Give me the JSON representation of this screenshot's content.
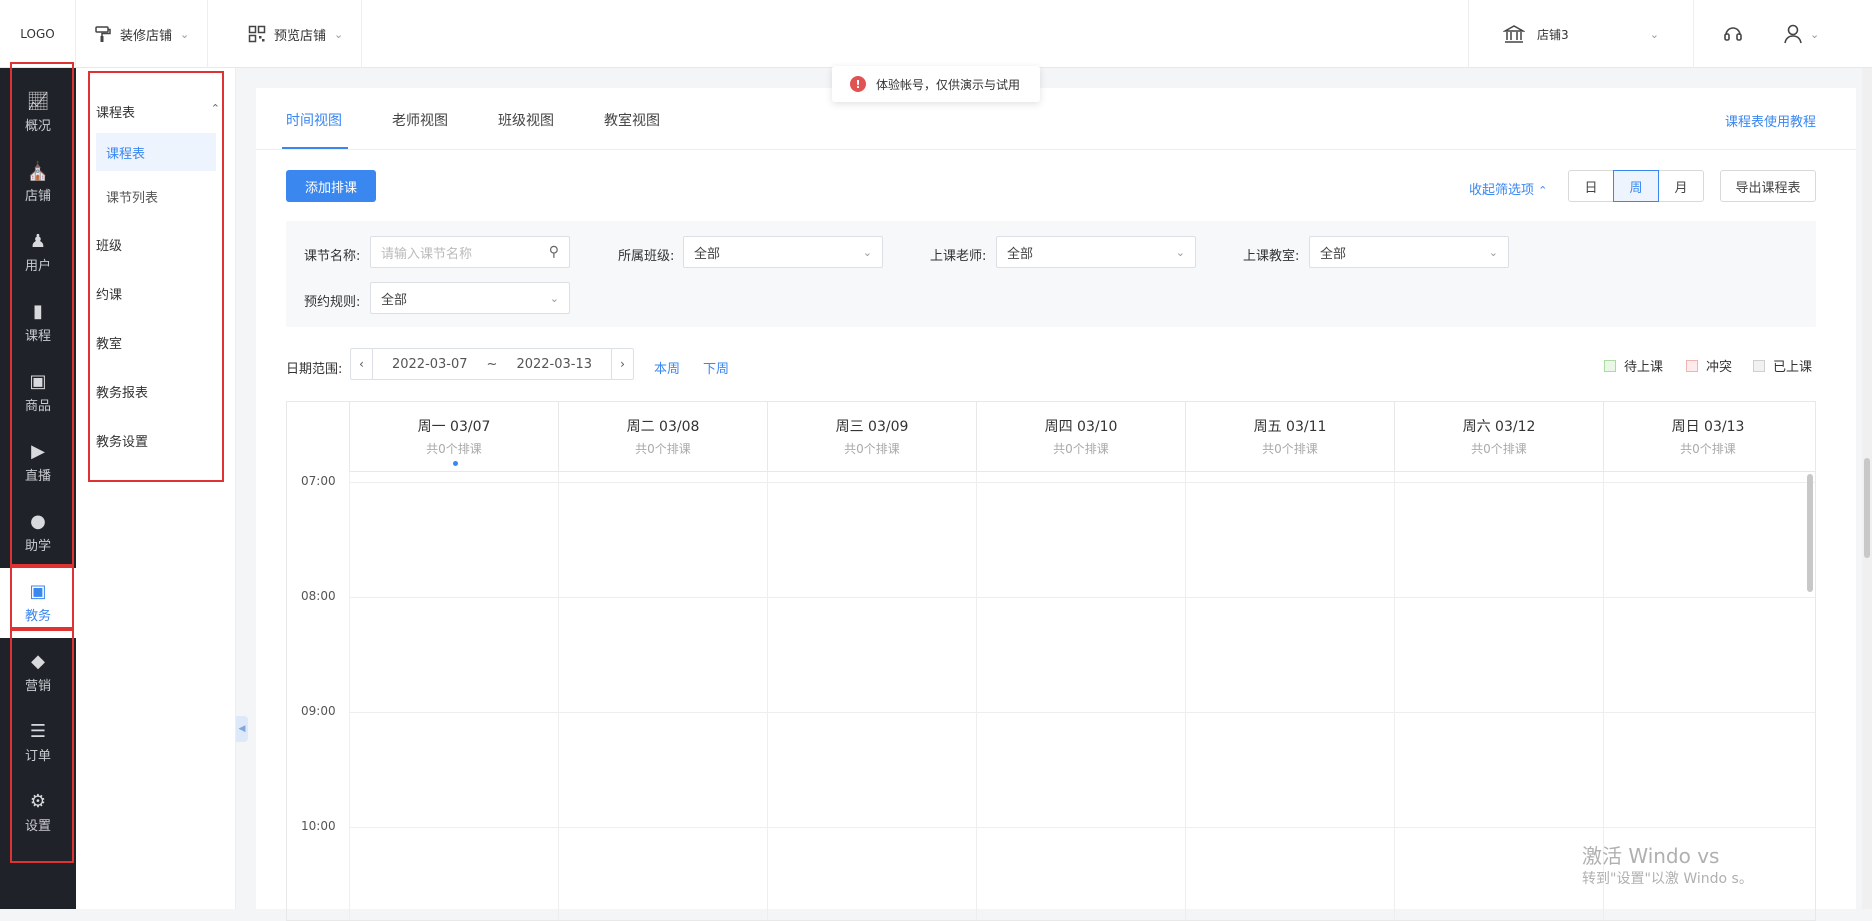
{
  "topbar": {
    "logo": "LOGO",
    "decorate_store": "装修店铺",
    "preview_store": "预览店铺",
    "store_name": "店铺3"
  },
  "icons": {
    "decorate": "paint-roller-icon",
    "preview": "qr-grid-icon",
    "store": "bank-icon",
    "support": "headset-icon",
    "user": "user-icon"
  },
  "toast": {
    "text": "体验帐号，仅供演示与试用"
  },
  "sidenav": [
    {
      "label": "概况",
      "icon": "chart-icon"
    },
    {
      "label": "店铺",
      "icon": "shop-icon"
    },
    {
      "label": "用户",
      "icon": "users-icon"
    },
    {
      "label": "课程",
      "icon": "book-icon"
    },
    {
      "label": "商品",
      "icon": "bag-icon"
    },
    {
      "label": "直播",
      "icon": "video-icon"
    },
    {
      "label": "助学",
      "icon": "gamepad-icon"
    },
    {
      "label": "教务",
      "icon": "calendar-icon",
      "active": true
    },
    {
      "label": "营销",
      "icon": "tag-icon"
    },
    {
      "label": "订单",
      "icon": "document-icon"
    },
    {
      "label": "设置",
      "icon": "gear-icon"
    }
  ],
  "subnav": {
    "group": "课程表",
    "children": [
      "课程表",
      "课节列表"
    ],
    "items": [
      "班级",
      "约课",
      "教室",
      "教务报表",
      "教务设置"
    ]
  },
  "tabs": [
    "时间视图",
    "老师视图",
    "班级视图",
    "教室视图"
  ],
  "help_link": "课程表使用教程",
  "toolbar": {
    "add_schedule": "添加排课",
    "collapse_filters": "收起筛选项",
    "views": [
      "日",
      "周",
      "月"
    ],
    "active_view": "周",
    "export": "导出课程表"
  },
  "filters": {
    "lesson_name_label": "课节名称:",
    "lesson_name_placeholder": "请输入课节名称",
    "class_label": "所属班级:",
    "class_value": "全部",
    "teacher_label": "上课老师:",
    "teacher_value": "全部",
    "room_label": "上课教室:",
    "room_value": "全部",
    "booking_label": "预约规则:",
    "booking_value": "全部"
  },
  "date_range": {
    "label": "日期范围:",
    "start": "2022-03-07",
    "sep": "~",
    "end": "2022-03-13",
    "this_week": "本周",
    "next_week": "下周"
  },
  "legend": [
    {
      "label": "待上课",
      "fill": "#eaf7e6",
      "border": "#a9dca0"
    },
    {
      "label": "冲突",
      "fill": "#fdeceb",
      "border": "#f0b3ae"
    },
    {
      "label": "已上课",
      "fill": "#f1f1f1",
      "border": "#cfcfcf"
    }
  ],
  "calendar": {
    "days": [
      {
        "name": "周一 03/07",
        "count": "共0个排课"
      },
      {
        "name": "周二 03/08",
        "count": "共0个排课"
      },
      {
        "name": "周三 03/09",
        "count": "共0个排课"
      },
      {
        "name": "周四 03/10",
        "count": "共0个排课"
      },
      {
        "name": "周五 03/11",
        "count": "共0个排课"
      },
      {
        "name": "周六 03/12",
        "count": "共0个排课"
      },
      {
        "name": "周日 03/13",
        "count": "共0个排课"
      }
    ],
    "times": [
      "07:00",
      "08:00",
      "09:00",
      "10:00"
    ]
  },
  "watermark": {
    "line1": "激活 Windo  vs",
    "line2": "转到\"设置\"以激  Windo  s。"
  },
  "colors": {
    "accent": "#3a87f0",
    "sidebar_bg": "#1f2229",
    "highlight_border": "#d33333"
  }
}
